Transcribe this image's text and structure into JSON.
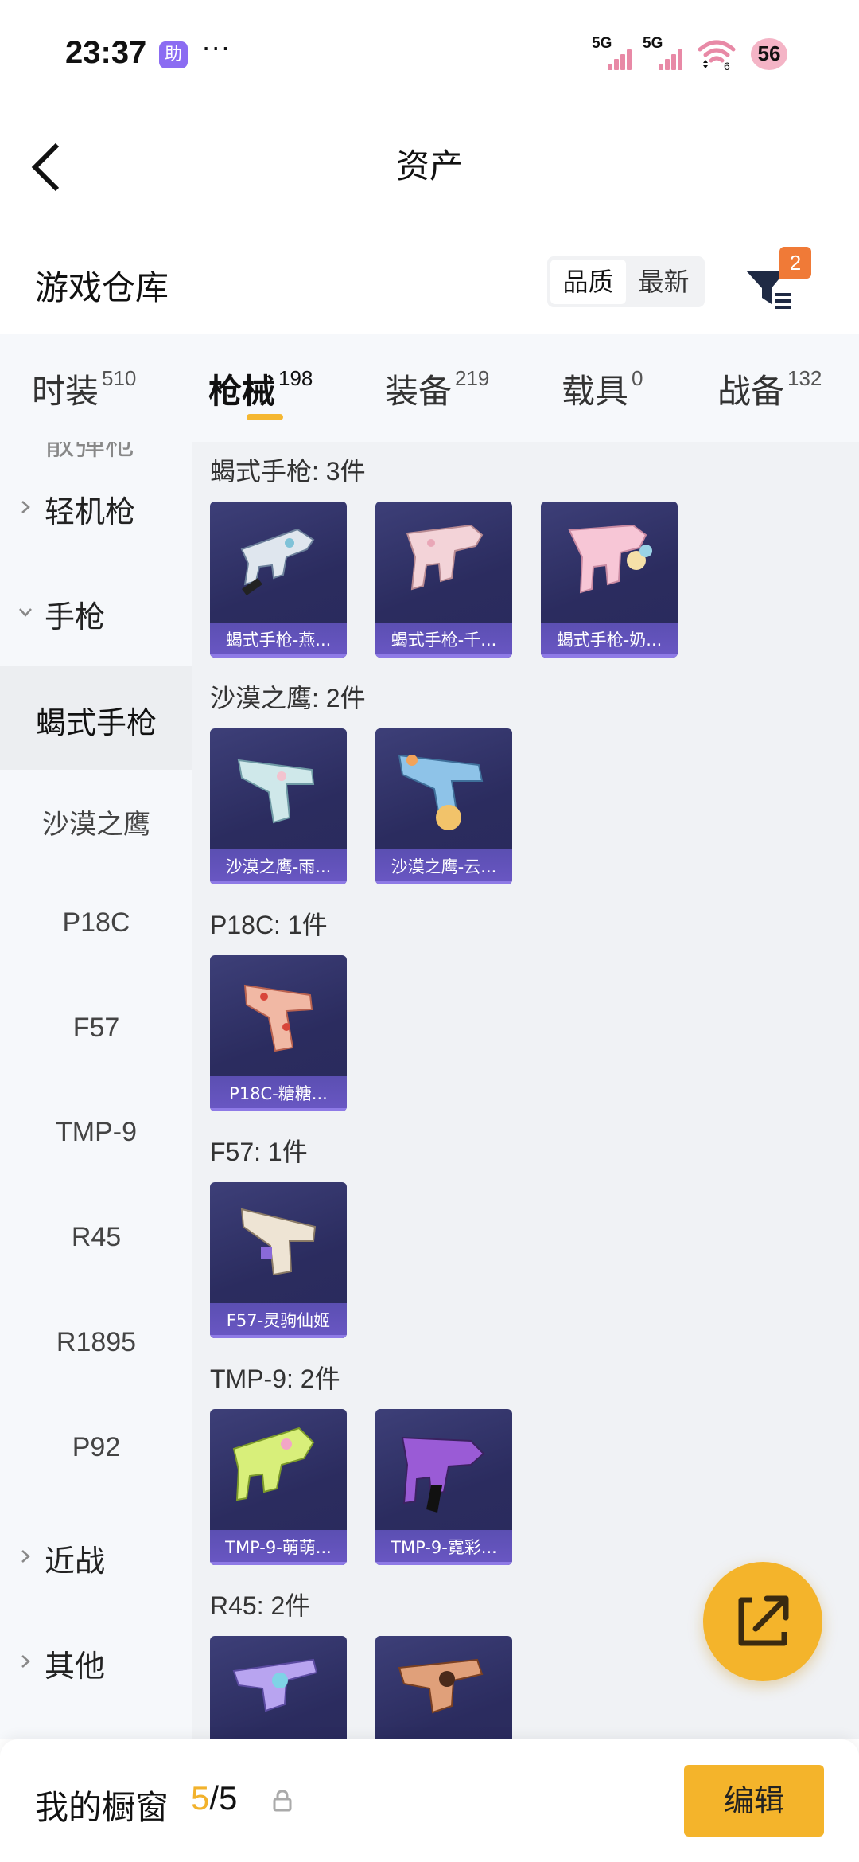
{
  "status_bar": {
    "time": "23:37",
    "assist_badge": "助",
    "more": "···",
    "signal_1": "5G",
    "signal_2": "5G",
    "wifi_level": "6",
    "battery": "56"
  },
  "header": {
    "title": "资产"
  },
  "warehouse": {
    "title": "游戏仓库",
    "sort_options": [
      "品质",
      "最新"
    ],
    "active_sort": "品质",
    "filter_badge": "2"
  },
  "tabs": [
    {
      "label": "时装",
      "count": "510"
    },
    {
      "label": "枪械",
      "count": "198",
      "active": true
    },
    {
      "label": "装备",
      "count": "219"
    },
    {
      "label": "载具",
      "count": "0"
    },
    {
      "label": "战备",
      "count": "132"
    }
  ],
  "sidebar": {
    "cut_top_label": "散弹枪",
    "items": [
      {
        "label": "轻机枪",
        "type": "group",
        "expanded": false
      },
      {
        "label": "手枪",
        "type": "group",
        "expanded": true
      },
      {
        "label": "蝎式手枪",
        "type": "sub",
        "active": true
      },
      {
        "label": "沙漠之鹰",
        "type": "sub"
      },
      {
        "label": "P18C",
        "type": "sub"
      },
      {
        "label": "F57",
        "type": "sub"
      },
      {
        "label": "TMP-9",
        "type": "sub"
      },
      {
        "label": "R45",
        "type": "sub"
      },
      {
        "label": "R1895",
        "type": "sub"
      },
      {
        "label": "P92",
        "type": "sub"
      },
      {
        "label": "近战",
        "type": "group",
        "expanded": false
      },
      {
        "label": "其他",
        "type": "group",
        "expanded": false
      }
    ]
  },
  "sections": [
    {
      "title": "蝎式手枪: 3件",
      "items": [
        "蝎式手枪-燕...",
        "蝎式手枪-千...",
        "蝎式手枪-奶..."
      ]
    },
    {
      "title": "沙漠之鹰: 2件",
      "items": [
        "沙漠之鹰-雨...",
        "沙漠之鹰-云..."
      ]
    },
    {
      "title": "P18C: 1件",
      "items": [
        "P18C-糖糖..."
      ]
    },
    {
      "title": "F57: 1件",
      "items": [
        "F57-灵驹仙姬"
      ]
    },
    {
      "title": "TMP-9: 2件",
      "items": [
        "TMP-9-萌萌...",
        "TMP-9-霓彩..."
      ]
    },
    {
      "title": "R45: 2件",
      "items": [
        "",
        ""
      ]
    }
  ],
  "bottom_bar": {
    "label": "我的橱窗",
    "used": "5",
    "separator": "/",
    "total": "5",
    "edit_label": "编辑"
  },
  "colors": {
    "accent": "#f4b42b",
    "card_bg": "#2b2c5f",
    "card_caption": "#5b4fb2",
    "filter_badge": "#f07a37",
    "page_bg": "#f0f2f5"
  }
}
